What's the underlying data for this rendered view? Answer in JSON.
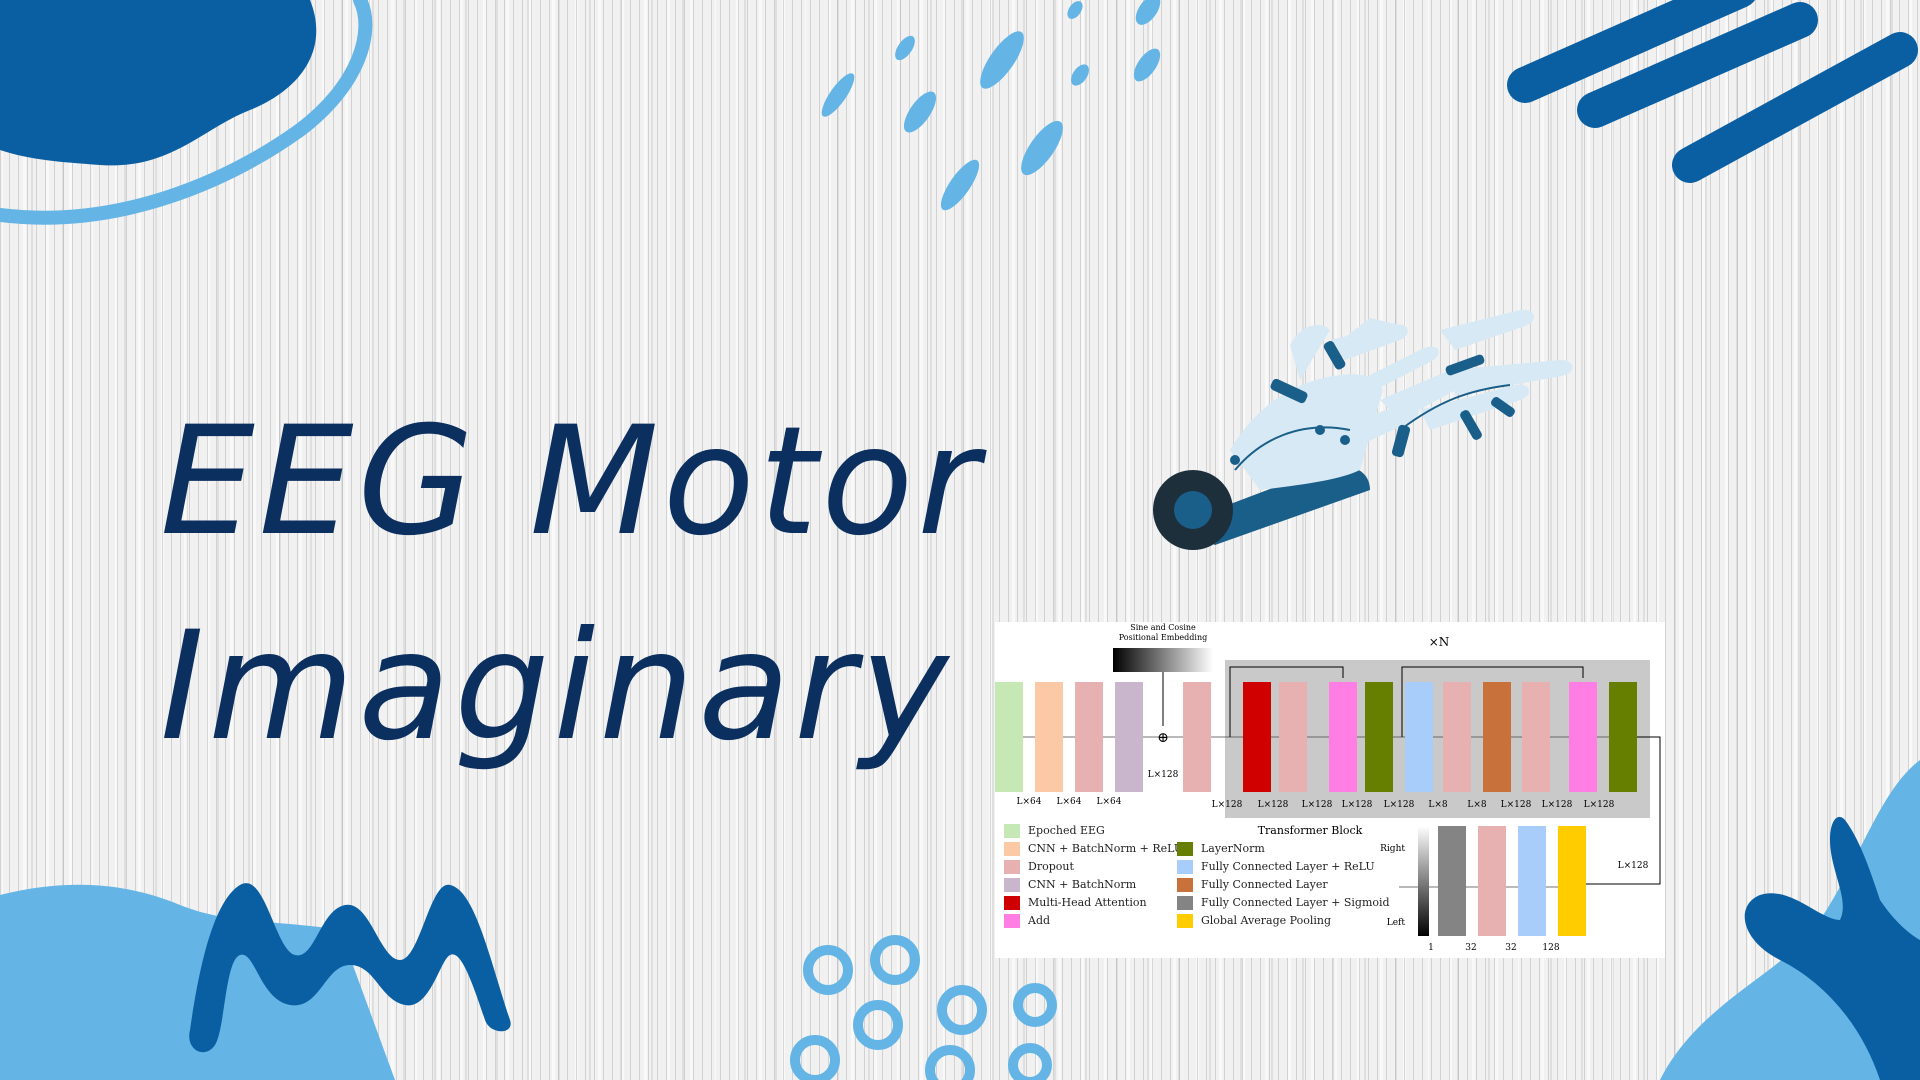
{
  "title": {
    "line1": "EEG Motor",
    "line2": "Imaginary"
  },
  "colors": {
    "title": "#0b2f5e",
    "dark_blue": "#0a5fa3",
    "light_blue": "#64b5e5"
  },
  "diagram": {
    "pos_embedding_label_1": "Sine and Cosine",
    "pos_embedding_label_2": "Positional Embedding",
    "repeat_label": "×N",
    "transformer_label": "Transformer Block",
    "add_symbol": "⊕",
    "l128_after_add": "L×128",
    "encoder_dims": [
      "L×64",
      "L×64",
      "L×64"
    ],
    "transformer_dims": [
      "L×128",
      "L×128",
      "L×128",
      "L×128",
      "L×128",
      "L×8",
      "L×8",
      "L×128",
      "L×128",
      "L×128"
    ],
    "head_in_label": "L×128",
    "output_dims": [
      "1",
      "32",
      "32",
      "128"
    ],
    "right_label": "Right",
    "left_label": "Left",
    "legend_left": [
      {
        "label": "Epoched EEG",
        "color": "#c5e8b5"
      },
      {
        "label": "CNN + BatchNorm + ReLU",
        "color": "#fcc9a6"
      },
      {
        "label": "Dropout",
        "color": "#e8b1b1"
      },
      {
        "label": "CNN + BatchNorm",
        "color": "#c9b6cc"
      },
      {
        "label": "Multi-Head Attention",
        "color": "#d10000"
      },
      {
        "label": "Add",
        "color": "#ff7ee3"
      }
    ],
    "legend_right": [
      {
        "label": "LayerNorm",
        "color": "#667f00"
      },
      {
        "label": "Fully Connected Layer + ReLU",
        "color": "#a9cdfb"
      },
      {
        "label": "Fully Connected Layer",
        "color": "#c8713a"
      },
      {
        "label": "Fully Connected Layer + Sigmoid",
        "color": "#848484"
      },
      {
        "label": "Global Average Pooling",
        "color": "#ffcc00"
      }
    ]
  }
}
